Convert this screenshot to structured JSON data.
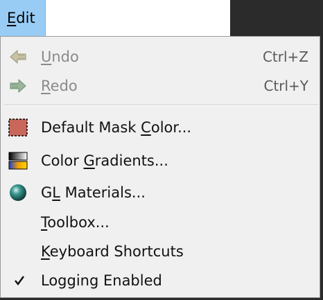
{
  "menubar": {
    "edit_label": "Edit"
  },
  "menu": {
    "items": [
      {
        "label": "Undo",
        "shortcut": "Ctrl+Z",
        "enabled": false
      },
      {
        "label": "Redo",
        "shortcut": "Ctrl+Y",
        "enabled": false
      },
      {
        "label": "Default Mask Color...",
        "icon": "mask-color-swatch-icon"
      },
      {
        "label": "Color Gradients...",
        "icon": "color-gradient-icon"
      },
      {
        "label": "GL Materials...",
        "icon": "gl-sphere-icon"
      },
      {
        "label": "Toolbox..."
      },
      {
        "label": "Keyboard Shortcuts"
      },
      {
        "label": "Logging Enabled",
        "checked": true
      }
    ]
  },
  "colors": {
    "menubar_highlight": "#99ccf5",
    "menu_background": "#f0f0f0",
    "mask_color": "#c9675a"
  }
}
